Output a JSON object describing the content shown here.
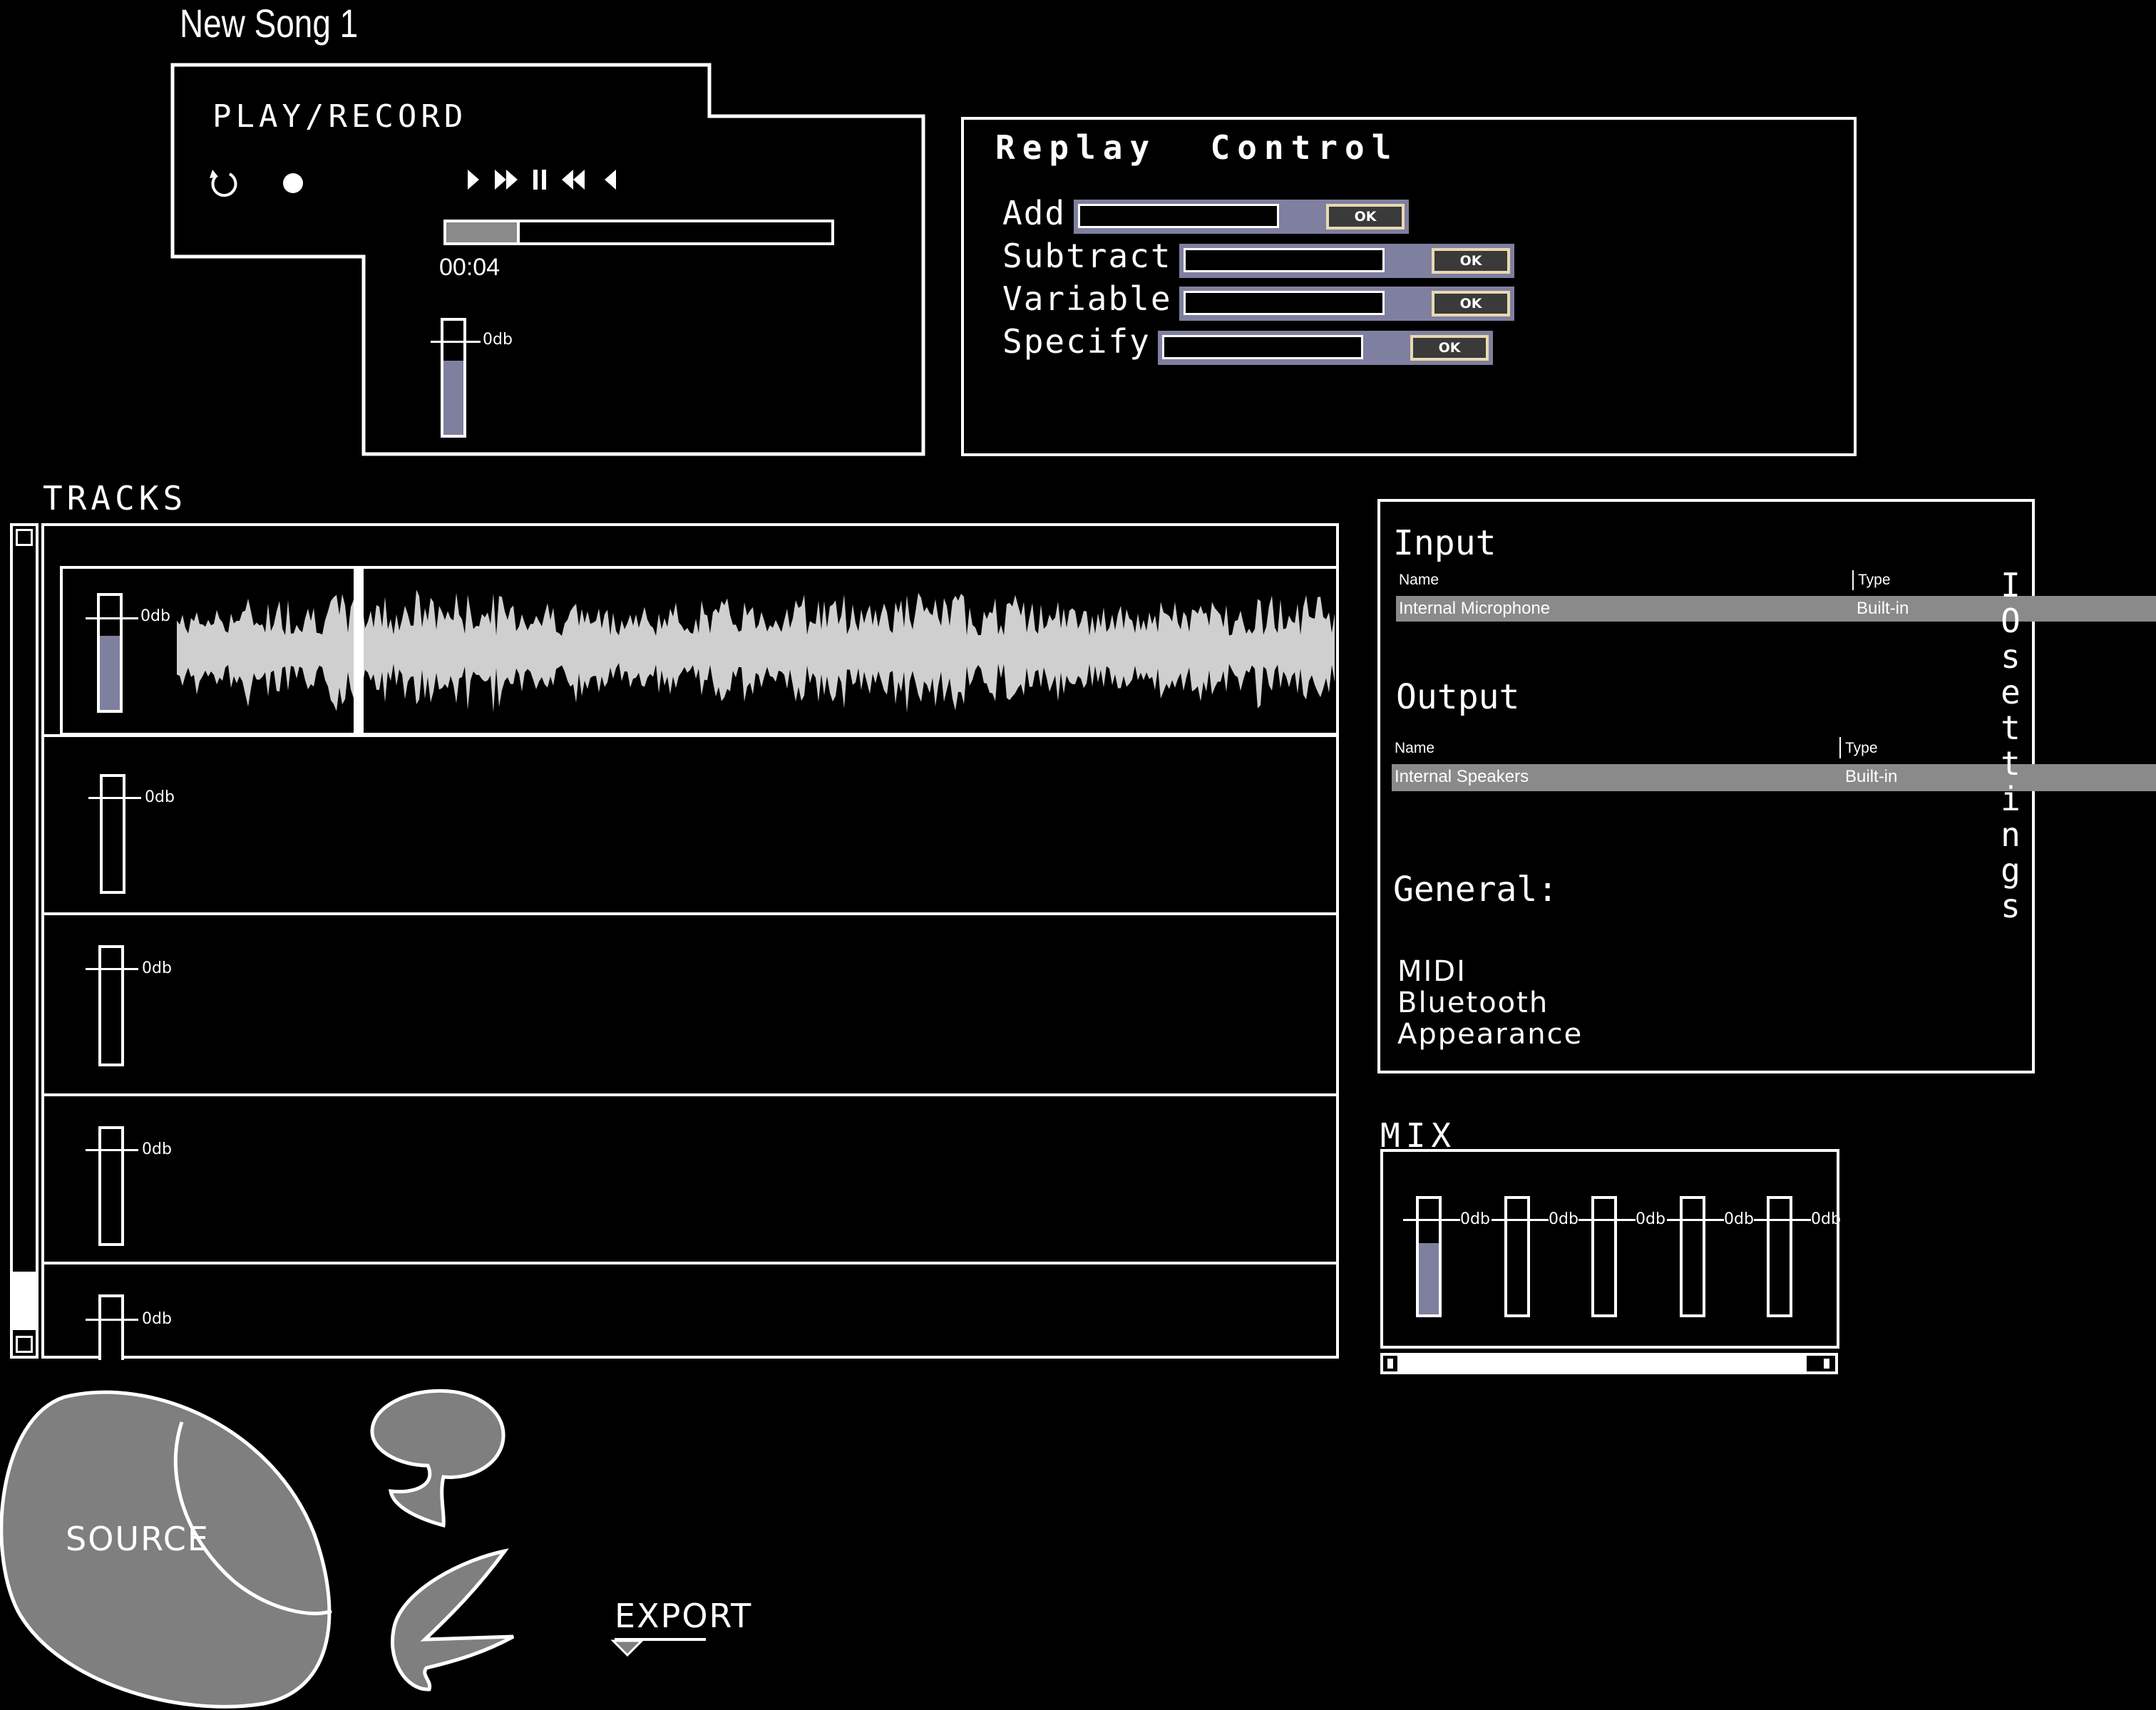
{
  "app": {
    "title": "New Song 1"
  },
  "play_record": {
    "title": "PLAY/RECORD",
    "time": "00:04",
    "progress": 0.19,
    "volume_label": "0db",
    "volume_level": 0.65,
    "icons": [
      "loop-icon",
      "record-icon",
      "play-icon",
      "fast-forward-icon",
      "pause-icon",
      "rewind-icon",
      "step-back-icon"
    ]
  },
  "replay_control": {
    "title": "Replay  Control",
    "rows": [
      {
        "label": "Add",
        "ok": "OK"
      },
      {
        "label": "Subtract",
        "ok": "OK"
      },
      {
        "label": "Variable",
        "ok": "OK"
      },
      {
        "label": "Specify",
        "ok": "OK"
      }
    ]
  },
  "tracks": {
    "title": "TRACKS",
    "items": [
      {
        "label": "0db",
        "level": 0.65,
        "has_waveform": true
      },
      {
        "label": "0db",
        "level": 0
      },
      {
        "label": "0db",
        "level": 0
      },
      {
        "label": "0db",
        "level": 0
      },
      {
        "label": "0db",
        "level": 0
      }
    ]
  },
  "io_settings": {
    "vertical_title": "IO settings",
    "input": {
      "heading": "Input",
      "col_name": "Name",
      "col_type": "Type",
      "rows": [
        {
          "name": "Internal Microphone",
          "type": "Built-in"
        }
      ]
    },
    "output": {
      "heading": "Output",
      "col_name": "Name",
      "col_type": "Type",
      "rows": [
        {
          "name": "Internal Speakers",
          "type": "Built-in"
        }
      ]
    },
    "general": {
      "heading": "General:",
      "items": [
        "MIDI",
        "Bluetooth",
        "Appearance"
      ]
    }
  },
  "mix": {
    "title": "MIX",
    "channels": [
      {
        "label": "0db",
        "level": 0.62
      },
      {
        "label": "0db",
        "level": 0
      },
      {
        "label": "0db",
        "level": 0
      },
      {
        "label": "0db",
        "level": 0
      },
      {
        "label": "0db",
        "level": 0
      }
    ]
  },
  "bottom": {
    "source_label": "SOURCE",
    "export_label": "EXPORT"
  },
  "colors": {
    "background": "#000000",
    "foreground": "#ffffff",
    "accent": "#7f7f9f",
    "shape_fill": "#7f7f7f"
  }
}
